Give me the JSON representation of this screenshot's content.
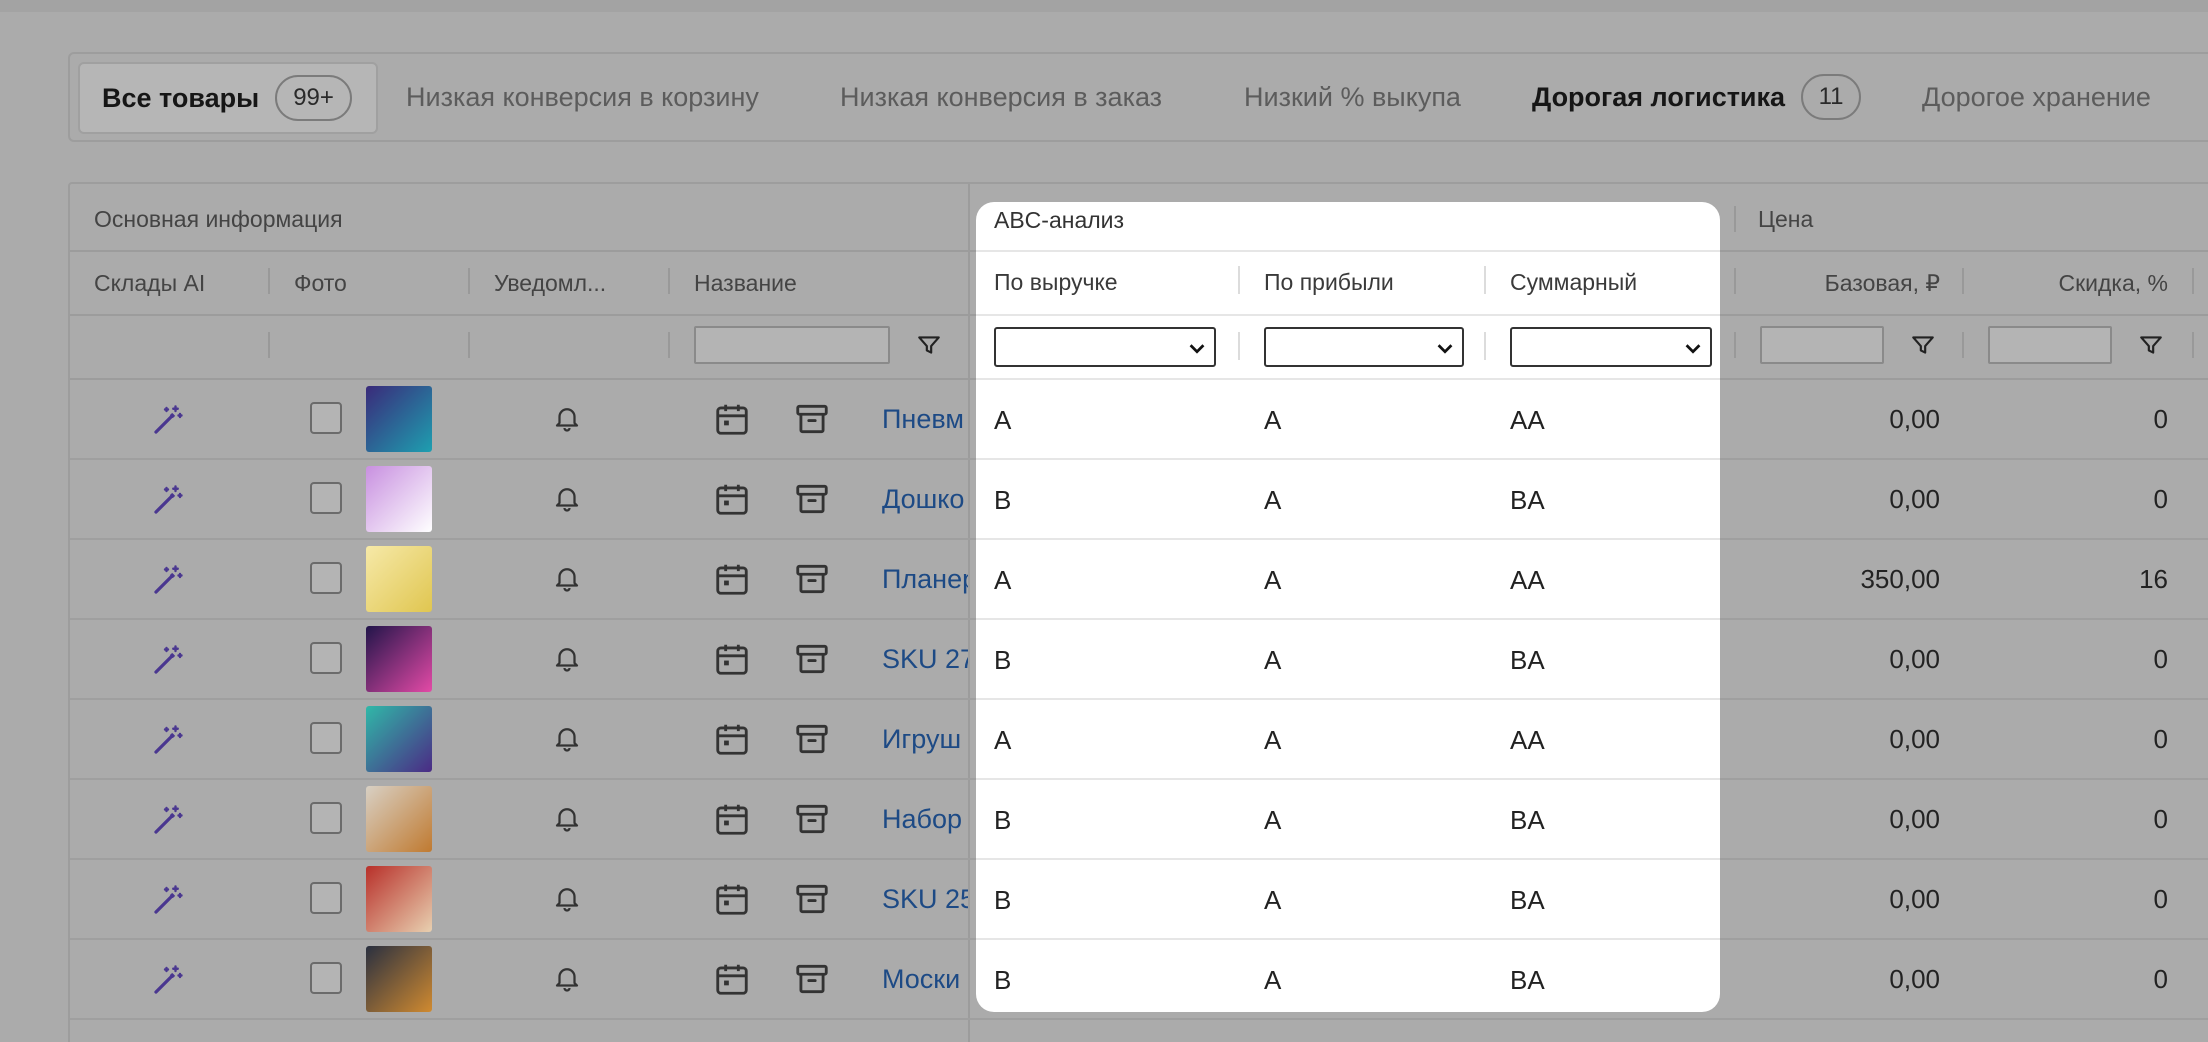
{
  "tabs": [
    {
      "label": "Все товары",
      "badge": "99+",
      "active": true
    },
    {
      "label": "Низкая конверсия в корзину"
    },
    {
      "label": "Низкая конверсия в заказ"
    },
    {
      "label": "Низкий % выкупа"
    },
    {
      "label": "Дорогая логистика",
      "badge": "11",
      "bold": true
    },
    {
      "label": "Дорогое хранение"
    }
  ],
  "groups": {
    "main": "Основная информация",
    "abc": "ABC-анализ",
    "price": "Цена"
  },
  "columns": {
    "warehouses_ai": "Склады AI",
    "photo": "Фото",
    "notifications": "Уведомл...",
    "name": "Название",
    "by_revenue": "По выручке",
    "by_profit": "По прибыли",
    "total": "Суммарный",
    "base_price": "Базовая, ₽",
    "discount": "Скидка, %"
  },
  "rows": [
    {
      "name": "Пневм",
      "rev": "A",
      "profit": "A",
      "total": "AA",
      "base": "0,00",
      "discount": "0"
    },
    {
      "name": "Дошко",
      "rev": "B",
      "profit": "A",
      "total": "BA",
      "base": "0,00",
      "discount": "0"
    },
    {
      "name": "Планер",
      "rev": "A",
      "profit": "A",
      "total": "AA",
      "base": "350,00",
      "discount": "16"
    },
    {
      "name": "SKU 27",
      "rev": "B",
      "profit": "A",
      "total": "BA",
      "base": "0,00",
      "discount": "0"
    },
    {
      "name": "Игруш",
      "rev": "A",
      "profit": "A",
      "total": "AA",
      "base": "0,00",
      "discount": "0"
    },
    {
      "name": "Набор",
      "rev": "B",
      "profit": "A",
      "total": "BA",
      "base": "0,00",
      "discount": "0"
    },
    {
      "name": "SKU 25",
      "rev": "B",
      "profit": "A",
      "total": "BA",
      "base": "0,00",
      "discount": "0"
    },
    {
      "name": "Моски",
      "rev": "B",
      "profit": "A",
      "total": "BA",
      "base": "0,00",
      "discount": "0"
    }
  ],
  "icons": {
    "warehouse": "magic-wand-icon",
    "notify": "bell-icon",
    "calendar": "calendar-icon",
    "archive": "archive-icon",
    "filter": "filter-icon"
  },
  "colors": {
    "accent": "#5b3fa0",
    "link": "#1d4a85"
  }
}
